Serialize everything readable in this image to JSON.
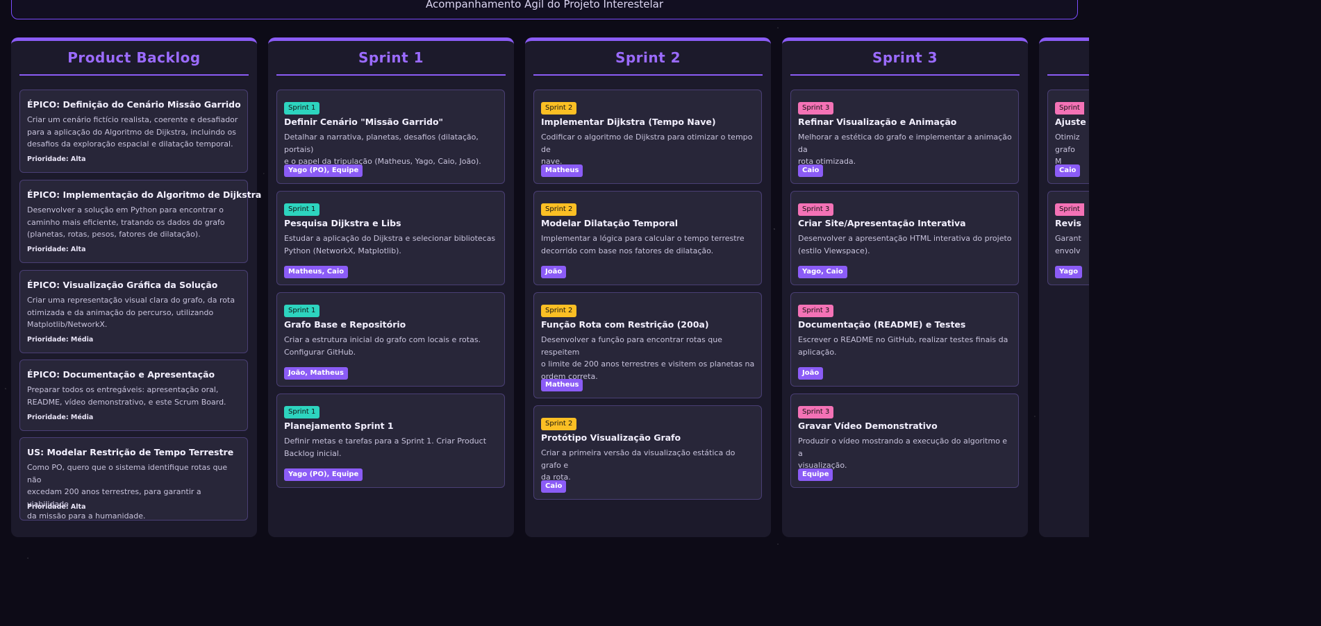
{
  "header": {
    "subtitle": "Acompanhamento Ágil do Projeto Interestelar"
  },
  "backlog": {
    "title": "Product Backlog",
    "items": [
      {
        "title": "ÉPICO: Definição do Cenário Missão Garrido",
        "lines": [
          "Criar um cenário fictício realista, coerente e desafiador",
          "para a aplicação do Algoritmo de Dijkstra, incluindo os",
          "desafios da exploração espacial e dilatação temporal."
        ],
        "priority": "Prioridade: Alta"
      },
      {
        "title": "ÉPICO: Implementação do Algoritmo de Dijkstra",
        "lines": [
          "Desenvolver a solução em Python para encontrar o",
          "caminho mais eficiente, tratando os dados do grafo",
          "(planetas, rotas, pesos, fatores de dilatação)."
        ],
        "priority": "Prioridade: Alta"
      },
      {
        "title": "ÉPICO: Visualização Gráfica da Solução",
        "lines": [
          "Criar uma representação visual clara do grafo, da rota",
          "otimizada e da animação do percurso, utilizando",
          "Matplotlib/NetworkX."
        ],
        "priority": "Prioridade: Média"
      },
      {
        "title": "ÉPICO: Documentação e Apresentação",
        "lines": [
          "Preparar todos os entregáveis: apresentação oral,",
          "README, vídeo demonstrativo, e este Scrum Board."
        ],
        "priority": "Prioridade: Média"
      },
      {
        "title": "US: Modelar Restrição de Tempo Terrestre",
        "lines": [
          "Como PO, quero que o sistema identifique rotas que não",
          "excedam 200 anos terrestres, para garantir a viabilidade",
          "da missão para a humanidade."
        ],
        "priority": "Prioridade: Alta"
      }
    ]
  },
  "sprint1": {
    "title": "Sprint 1",
    "cards": [
      {
        "badge": "Sprint 1",
        "title": "Definir Cenário \"Missão Garrido\"",
        "lines": [
          "Detalhar a narrativa, planetas, desafios (dilatação, portais)",
          "e o papel da tripulação (Matheus, Yago, Caio, João)."
        ],
        "assignee": "Yago (PO), Equipe"
      },
      {
        "badge": "Sprint 1",
        "title": "Pesquisa Dijkstra e Libs",
        "lines": [
          "Estudar a aplicação do Dijkstra e selecionar bibliotecas",
          "Python (NetworkX, Matplotlib)."
        ],
        "assignee": "Matheus, Caio"
      },
      {
        "badge": "Sprint 1",
        "title": "Grafo Base e Repositório",
        "lines": [
          "Criar a estrutura inicial do grafo com locais e rotas.",
          "Configurar GitHub."
        ],
        "assignee": "João, Matheus"
      },
      {
        "badge": "Sprint 1",
        "title": "Planejamento Sprint 1",
        "lines": [
          "Definir metas e tarefas para a Sprint 1. Criar Product",
          "Backlog inicial."
        ],
        "assignee": "Yago (PO), Equipe"
      }
    ]
  },
  "sprint2": {
    "title": "Sprint 2",
    "cards": [
      {
        "badge": "Sprint 2",
        "title": "Implementar Dijkstra (Tempo Nave)",
        "lines": [
          "Codificar o algoritmo de Dijkstra para otimizar o tempo de",
          "nave."
        ],
        "assignee": "Matheus"
      },
      {
        "badge": "Sprint 2",
        "title": "Modelar Dilatação Temporal",
        "lines": [
          "Implementar a lógica para calcular o tempo terrestre",
          "decorrido com base nos fatores de dilatação."
        ],
        "assignee": "João"
      },
      {
        "badge": "Sprint 2",
        "title": "Função Rota com Restrição (200a)",
        "lines": [
          "Desenvolver a função para encontrar rotas que respeitem",
          "o limite de 200 anos terrestres e visitem os planetas na",
          "ordem correta."
        ],
        "assignee": "Matheus"
      },
      {
        "badge": "Sprint 2",
        "title": "Protótipo Visualização Grafo",
        "lines": [
          "Criar a primeira versão da visualização estática do grafo e",
          "da rota."
        ],
        "assignee": "Caio"
      }
    ]
  },
  "sprint3": {
    "title": "Sprint 3",
    "cards": [
      {
        "badge": "Sprint 3",
        "title": "Refinar Visualização e Animação",
        "lines": [
          "Melhorar a estética do grafo e implementar a animação da",
          "rota otimizada."
        ],
        "assignee": "Caio"
      },
      {
        "badge": "Sprint 3",
        "title": "Criar Site/Apresentação Interativa",
        "lines": [
          "Desenvolver a apresentação HTML interativa do projeto",
          "(estilo Viewspace)."
        ],
        "assignee": "Yago, Caio"
      },
      {
        "badge": "Sprint 3",
        "title": "Documentação (README) e Testes",
        "lines": [
          "Escrever o README no GitHub, realizar testes finais da",
          "aplicação."
        ],
        "assignee": "João"
      },
      {
        "badge": "Sprint 3",
        "title": "Gravar Vídeo Demonstrativo",
        "lines": [
          "Produzir o vídeo mostrando a execução do algoritmo e a",
          "visualização."
        ],
        "assignee": "Equipe"
      }
    ]
  },
  "partial": {
    "cards": [
      {
        "badge": "Sprint",
        "title": "Ajuste",
        "lines": [
          "Otimiz",
          "grafo M"
        ],
        "assignee": "Caio"
      },
      {
        "badge": "Sprint",
        "title": "Revis",
        "lines": [
          "Garant",
          "envolv"
        ],
        "assignee": "Yago"
      }
    ]
  }
}
